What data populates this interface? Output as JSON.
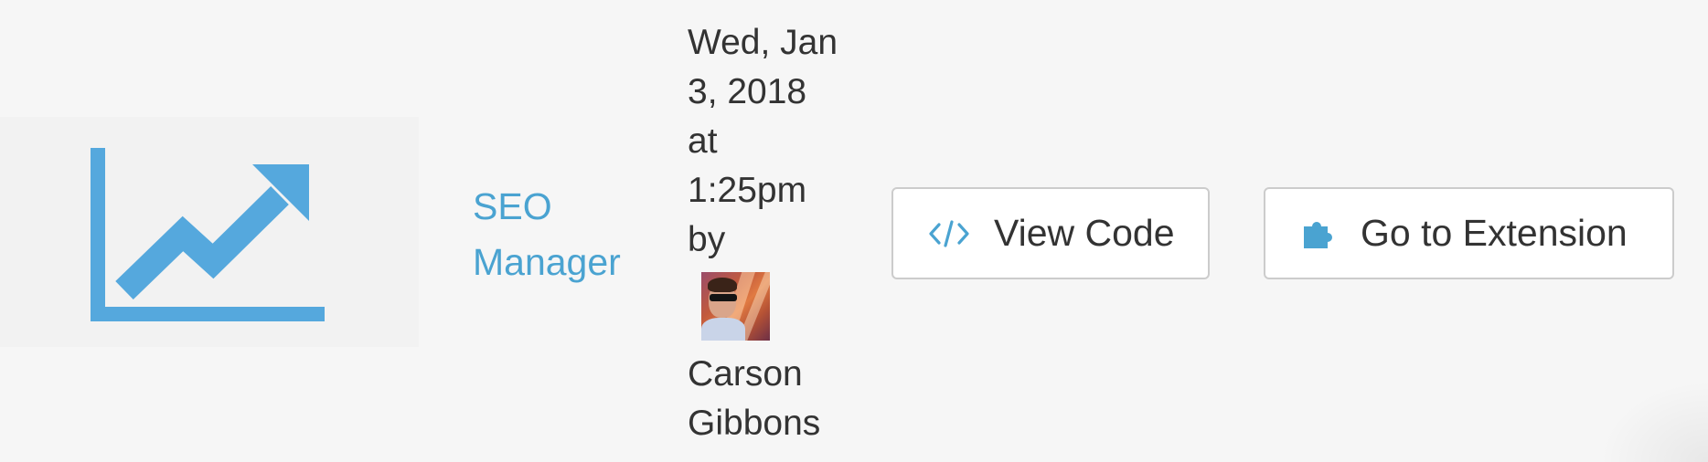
{
  "extension": {
    "name_line1": "SEO",
    "name_line2": "Manager",
    "icon": "trending-up-chart-icon"
  },
  "meta": {
    "date_line1": "Wed, Jan",
    "date_line2": "3, 2018",
    "at": "at",
    "time": "1:25pm",
    "by": "by",
    "author_first": "Carson",
    "author_last": "Gibbons"
  },
  "buttons": {
    "view_code": "View Code",
    "view_code_icon": "code-icon",
    "go_to_extension": "Go to Extension",
    "go_to_extension_icon": "puzzle-piece-icon"
  },
  "colors": {
    "accent": "#4aa3d1",
    "icon_blue": "#55a8dd",
    "text": "#333333",
    "button_border": "#cccccc"
  }
}
